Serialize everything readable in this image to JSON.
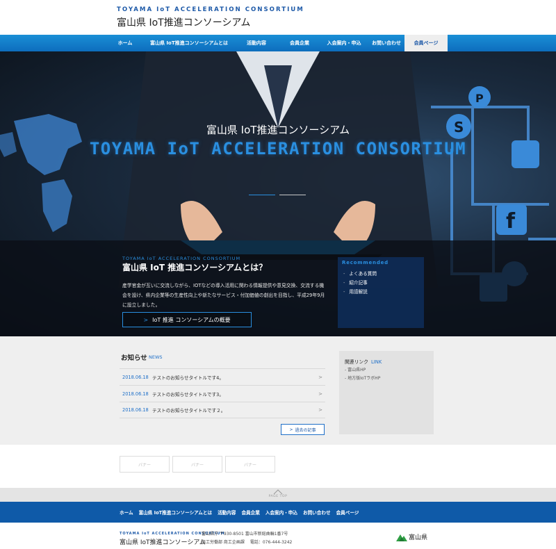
{
  "header": {
    "brand_en": "TOYAMA IoT ACCELERATION CONSORTIUM",
    "brand_ja": "富山県 IoT推進コンソーシアム"
  },
  "nav": {
    "items": [
      {
        "label": "ホーム"
      },
      {
        "label": "富山県 IoT推進コンソーシアムとは"
      },
      {
        "label": "活動内容"
      },
      {
        "label": "会員企業"
      },
      {
        "label": "入会案内・申込"
      },
      {
        "label": "お問い合わせ"
      },
      {
        "label": "会員ページ"
      }
    ],
    "active_index": 6
  },
  "hero": {
    "title_ja": "富山県 IoT推進コンソーシアム",
    "title_en": "TOYAMA IoT ACCELERATION CONSORTIUM"
  },
  "about": {
    "label_en": "TOYAMA IoT ACCELERATION CONSORTIUM",
    "title": "富山県 IoT 推進コンソーシアムとは？",
    "description": "産学官金が互いに交流しながら、IOTなどの導入活用に関わる情報提供や意見交換、交流する機会を設け、県内企業等の生産性向上や新たなサービス・付加価値の創出を目指し、平成29年9月に設立しました。",
    "button_label": "IoT 推進 コンソーシアムの概要",
    "button_icon": ">"
  },
  "recommend": {
    "title": "Recommended",
    "items": [
      {
        "label": "よくある質問"
      },
      {
        "label": "紹介記事"
      },
      {
        "label": "用語解説"
      }
    ]
  },
  "news": {
    "title": "お知らせ",
    "title_en": "NEWS",
    "items": [
      {
        "date": "2018.06.18",
        "title": "テストのお知らせタイトルです4。"
      },
      {
        "date": "2018.06.18",
        "title": "テストのお知らせタイトルです3。"
      },
      {
        "date": "2018.06.18",
        "title": "テストのお知らせタイトルです２。"
      }
    ],
    "more_label": "過去の記事",
    "more_icon": ">"
  },
  "links": {
    "title": "関連リンク",
    "title_en": "LINK",
    "items": [
      {
        "label": "富山県HP"
      },
      {
        "label": "地方版IoTラボHP"
      }
    ]
  },
  "banners": [
    "バナー",
    "バナー",
    "バナー"
  ],
  "page_top": {
    "label": "PAGE TOP"
  },
  "footer": {
    "nav": [
      "ホーム",
      "富山県 IoT推進コンソーシアムとは",
      "活動内容",
      "会員企業",
      "入会案内・申込",
      "お問い合わせ",
      "会員ページ"
    ],
    "brand_en": "TOYAMA IoT ACCELERATION CONSORTIUM",
    "brand_ja": "富山県 IoT推進コンソーシアム",
    "address": "富山県庁 〒930-8501 富山市新総曲輪1番7号",
    "department": "商工労働部 商工企画課",
    "phone_label": "電話：",
    "phone": "076-444-3242",
    "pref_logo_text": "富山県"
  },
  "colors": {
    "accent": "#1e6fc8",
    "nav_bg": "#0d6dbd",
    "hero_title_en": "#2a8fe0",
    "footer_nav_bg": "#0f5aa8"
  }
}
